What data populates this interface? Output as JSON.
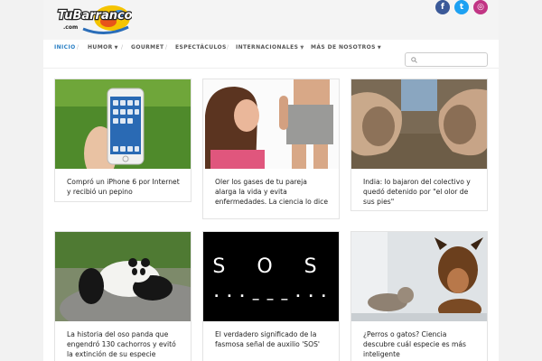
{
  "site": {
    "logo_text": "TuBarranco",
    "logo_sub": ".com"
  },
  "social": [
    {
      "name": "facebook",
      "glyph": "f",
      "color": "#3b5998"
    },
    {
      "name": "twitter",
      "glyph": "t",
      "color": "#1da1f2"
    },
    {
      "name": "instagram",
      "glyph": "◎",
      "color": "#c13584"
    }
  ],
  "nav": {
    "items": [
      {
        "label": "INICIO",
        "active": true,
        "dropdown": false
      },
      {
        "label": "HUMOR",
        "active": false,
        "dropdown": true
      },
      {
        "label": "GOURMET",
        "active": false,
        "dropdown": false
      },
      {
        "label": "ESPECTÁCULOS",
        "active": false,
        "dropdown": false
      },
      {
        "label": "INTERNACIONALES",
        "active": false,
        "dropdown": true
      },
      {
        "label": "MÁS DE NOSOTROS",
        "active": false,
        "dropdown": true
      }
    ],
    "search_placeholder": ""
  },
  "articles": [
    {
      "caption": "Compró un iPhone 6 por Internet y recibió un pepino",
      "image": "iphone-hand"
    },
    {
      "caption": "Oler los gases de tu pareja alarga la vida y evita enfermedades. La ciencia lo dice",
      "image": "couple-smell"
    },
    {
      "caption": "India: lo bajaron del colectivo y quedó detenido por \"el olor de sus pies\"",
      "image": "dirty-feet"
    },
    {
      "caption": "La historia del oso panda que engendró 130 cachorros y evitó la extinción de su especie",
      "image": "panda"
    },
    {
      "caption": "El verdadero significado de la fasmosa señal de auxilio 'SOS'",
      "image": "sos-morse",
      "image_text": "S O S",
      "image_morse": ". . . _ _ _ . . ."
    },
    {
      "caption": "¿Perros o gatos? Ciencia descubre cuál especie es más inteligente",
      "image": "dog-cat"
    }
  ]
}
